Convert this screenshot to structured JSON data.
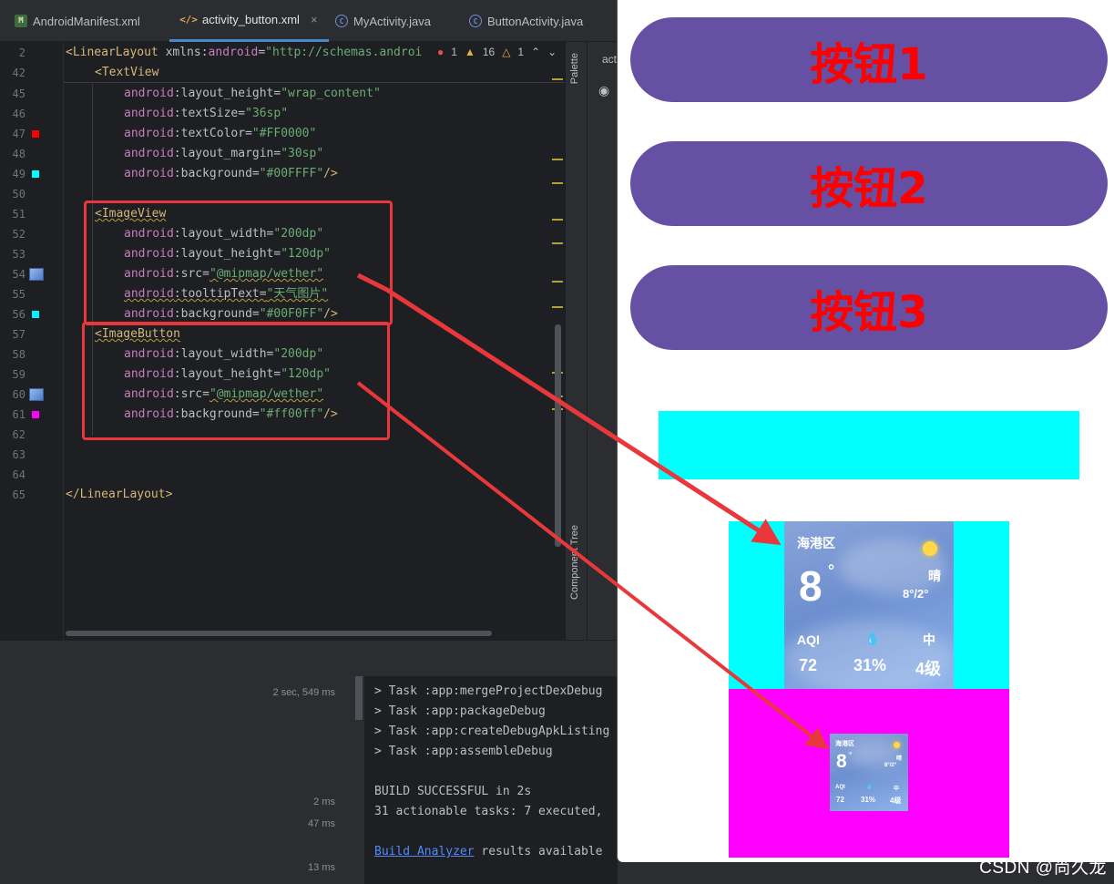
{
  "tabs": [
    {
      "icon": "M",
      "label": "AndroidManifest.xml"
    },
    {
      "icon": "</>",
      "label": "activity_button.xml",
      "close": "×"
    },
    {
      "icon": "C",
      "label": "MyActivity.java"
    },
    {
      "icon": "C",
      "label": "ButtonActivity.java"
    }
  ],
  "inspections": {
    "errors": "1",
    "warnings": "16",
    "weak": "1"
  },
  "side_panels": {
    "palette": "Palette",
    "component_tree": "Component Tree",
    "design_tab": "act"
  },
  "code": {
    "l2": {
      "num": "2",
      "tag": "<LinearLayout",
      "attr": " xmlns:",
      "ns": "android",
      "eq": "=",
      "val": "\"http://schemas.androi"
    },
    "l42": {
      "num": "42",
      "tag": "<TextView"
    },
    "lines": [
      {
        "num": "45",
        "ns": "android",
        "attr": ":layout_height=",
        "val": "\"wrap_content\"",
        "end": ""
      },
      {
        "num": "46",
        "ns": "android",
        "attr": ":textSize=",
        "val": "\"36sp\"",
        "end": ""
      },
      {
        "num": "47",
        "ns": "android",
        "attr": ":textColor=",
        "val": "\"#FF0000\"",
        "end": ""
      },
      {
        "num": "48",
        "ns": "android",
        "attr": ":layout_margin=",
        "val": "\"30sp\"",
        "end": ""
      },
      {
        "num": "49",
        "ns": "android",
        "attr": ":background=",
        "val": "\"#00FFFF\"",
        "end": "/>"
      }
    ],
    "l50": "50",
    "l51": {
      "num": "51",
      "tag": "<ImageView"
    },
    "iv_lines": [
      {
        "num": "52",
        "ns": "android",
        "attr": ":layout_width=",
        "val": "\"200dp\"",
        "end": ""
      },
      {
        "num": "53",
        "ns": "android",
        "attr": ":layout_height=",
        "val": "\"120dp\"",
        "end": ""
      },
      {
        "num": "54",
        "ns": "android",
        "attr": ":src=",
        "val": "\"@mipmap/wether\"",
        "end": ""
      },
      {
        "num": "55",
        "ns": "android",
        "attr": ":tooltipText=",
        "val": "\"天气图片\"",
        "end": ""
      },
      {
        "num": "56",
        "ns": "android",
        "attr": ":background=",
        "val": "\"#00F0FF\"",
        "end": "/>"
      }
    ],
    "l57": {
      "num": "57",
      "tag": "<ImageButton"
    },
    "ib_lines": [
      {
        "num": "58",
        "ns": "android",
        "attr": ":layout_width=",
        "val": "\"200dp\"",
        "end": ""
      },
      {
        "num": "59",
        "ns": "android",
        "attr": ":layout_height=",
        "val": "\"120dp\"",
        "end": ""
      },
      {
        "num": "60",
        "ns": "android",
        "attr": ":src=",
        "val": "\"@mipmap/wether\"",
        "end": ""
      },
      {
        "num": "61",
        "ns": "android",
        "attr": ":background=",
        "val": "\"#ff00ff\"",
        "end": "/>"
      }
    ],
    "l62": "62",
    "l63": "63",
    "l64": "64",
    "l65": {
      "num": "65",
      "tag": "</LinearLayout>"
    }
  },
  "gutter_colors": {
    "red": "#FF0000",
    "cyan": "#00FFFF",
    "cyan2": "#00F0FF",
    "magenta": "#ff00ff"
  },
  "build": {
    "times": [
      "2 sec, 549 ms",
      "2 ms",
      "47 ms",
      "13 ms"
    ],
    "console": [
      "> Task :app:mergeProjectDexDebug",
      "> Task :app:packageDebug",
      "> Task :app:createDebugApkListing",
      "> Task :app:assembleDebug",
      "",
      "BUILD SUCCESSFUL in 2s",
      "31 actionable tasks: 7 executed,"
    ],
    "analyzer_link": "Build Analyzer",
    "analyzer_rest": " results available"
  },
  "preview": {
    "buttons": [
      "按钮1",
      "按钮2",
      "按钮3"
    ],
    "weather": {
      "location": "海港区",
      "temp": "8",
      "degree": "°",
      "condition": "晴",
      "range": "8°/2°",
      "aqi_label": "AQI",
      "aqi": "72",
      "humidity": "31%",
      "wind_icon": "中",
      "wind": "4级",
      "drop": "💧"
    }
  },
  "watermark": "CSDN @尚久龙"
}
